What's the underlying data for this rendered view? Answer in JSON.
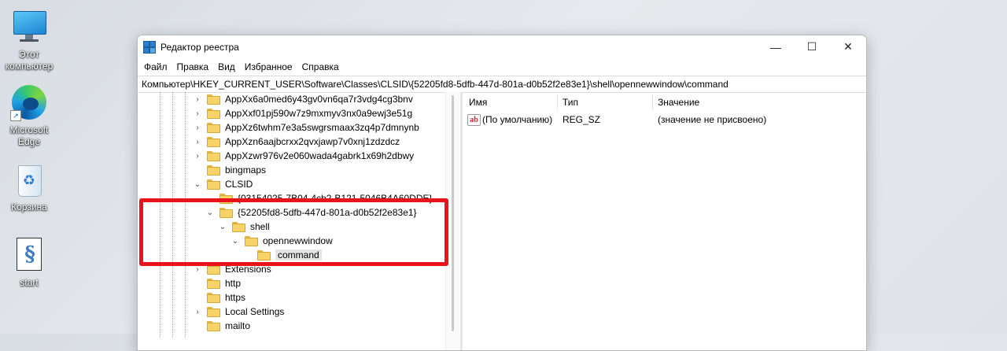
{
  "desktop": {
    "icons": [
      {
        "label": "Этот компьютер",
        "icon": "monitor-icon"
      },
      {
        "label": "Microsoft Edge",
        "icon": "edge-icon"
      },
      {
        "label": "Корзина",
        "icon": "recycle-bin-icon"
      },
      {
        "label": "start",
        "icon": "script-file-icon"
      }
    ]
  },
  "window": {
    "title": "Редактор реестра",
    "controls": {
      "minimize": "—",
      "maximize": "☐",
      "close": "✕"
    },
    "menu": [
      "Файл",
      "Правка",
      "Вид",
      "Избранное",
      "Справка"
    ],
    "address": "Компьютер\\HKEY_CURRENT_USER\\Software\\Classes\\CLSID\\{52205fd8-5dfb-447d-801a-d0b52f2e83e1}\\shell\\opennewwindow\\command"
  },
  "tree": {
    "nodes": [
      {
        "label": "AppXx6a0med6y43gv0vn6qa7r3vdg4cg3bnv",
        "chevron": "›"
      },
      {
        "label": "AppXxf01pj590w7z9mxmyv3nx0a9ewj3e51g",
        "chevron": "›"
      },
      {
        "label": "AppXz6twhm7e3a5swgrsmaax3zq4p7dmnynb",
        "chevron": "›"
      },
      {
        "label": "AppXzn6aajbcrxx2qvxjawp7v0xnj1zdzdcz",
        "chevron": "›"
      },
      {
        "label": "AppXzwr976v2e060wada4gabrk1x69h2dbwy",
        "chevron": "›"
      },
      {
        "label": "bingmaps",
        "chevron": ""
      },
      {
        "label": "CLSID",
        "chevron": "⌄"
      },
      {
        "label": "{03154025-7B04-4cb2-B121-5046B4A60DDE}",
        "chevron": ""
      },
      {
        "label": "{52205fd8-5dfb-447d-801a-d0b52f2e83e1}",
        "chevron": "⌄"
      },
      {
        "label": "shell",
        "chevron": "⌄"
      },
      {
        "label": "opennewwindow",
        "chevron": "⌄"
      },
      {
        "label": "command",
        "chevron": ""
      },
      {
        "label": "Extensions",
        "chevron": "›"
      },
      {
        "label": "http",
        "chevron": ""
      },
      {
        "label": "https",
        "chevron": ""
      },
      {
        "label": "Local Settings",
        "chevron": "›"
      },
      {
        "label": "mailto",
        "chevron": ""
      }
    ]
  },
  "values": {
    "columns": [
      "Имя",
      "Тип",
      "Значение"
    ],
    "rows": [
      {
        "icon": "ab",
        "name": "(По умолчанию)",
        "type": "REG_SZ",
        "data": "(значение не присвоено)"
      }
    ]
  }
}
